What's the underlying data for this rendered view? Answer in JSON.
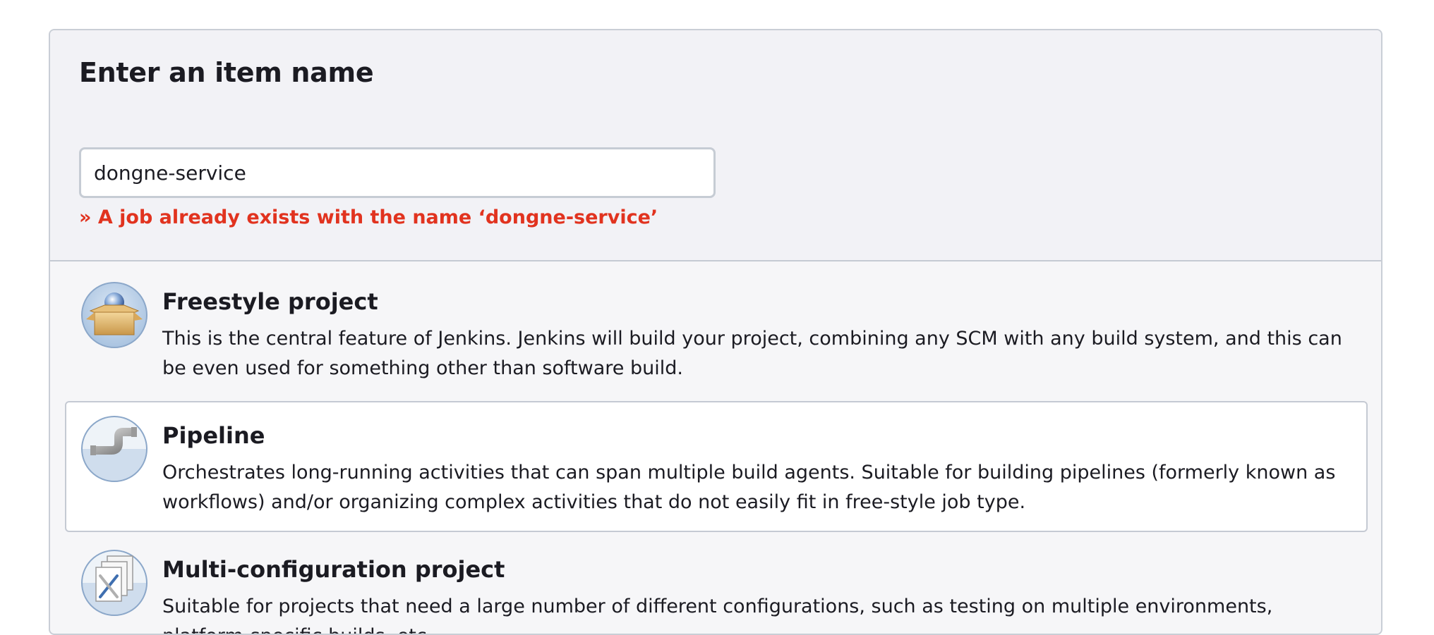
{
  "header": {
    "title": "Enter an item name"
  },
  "item_name": {
    "value": "dongne-service",
    "placeholder": ""
  },
  "validation": {
    "error": "» A job already exists with the name ‘dongne-service’"
  },
  "item_types": [
    {
      "name": "Freestyle project",
      "description": "This is the central feature of Jenkins. Jenkins will build your project, combining any SCM with any build system, and this can be even used for something other than software build.",
      "icon": "freestyle-project-icon",
      "selected": false
    },
    {
      "name": "Pipeline",
      "description": "Orchestrates long-running activities that can span multiple build agents. Suitable for building pipelines (formerly known as workflows) and/or organizing complex activities that do not easily fit in free-style job type.",
      "icon": "pipeline-icon",
      "selected": true
    },
    {
      "name": "Multi-configuration project",
      "description": "Suitable for projects that need a large number of different configurations, such as testing on multiple environments, platform-specific builds, etc.",
      "icon": "multi-configuration-project-icon",
      "selected": false
    }
  ],
  "colors": {
    "error": "#e1331f",
    "border": "#c5cad3",
    "panel_bg": "#f2f2f6",
    "selected_bg": "#ffffff"
  }
}
